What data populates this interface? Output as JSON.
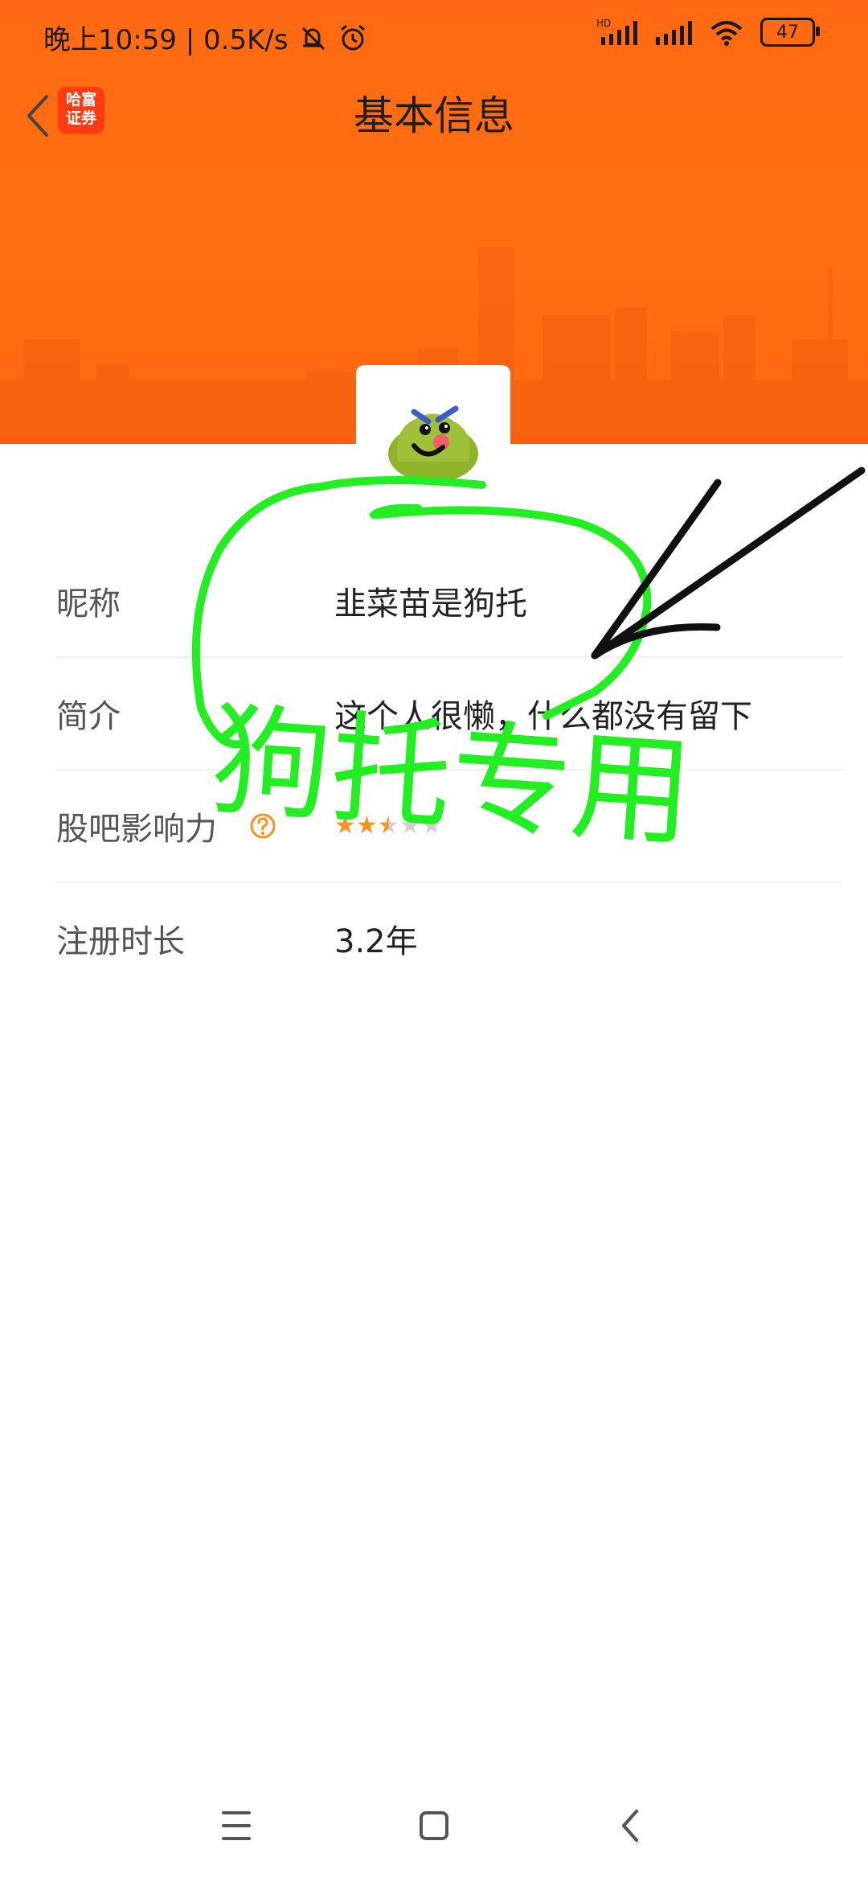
{
  "status_bar": {
    "time_speed": "晚上10:59 | 0.5K/s",
    "network_badge": "HD",
    "battery": "47",
    "icons": [
      "mute-bell-icon",
      "alarm-icon",
      "signal-icon",
      "signal-icon",
      "wifi-icon",
      "battery-icon"
    ]
  },
  "nav": {
    "title": "基本信息",
    "brand": "哈富证券",
    "back_icon": "chevron-left-icon"
  },
  "colors": {
    "header": "#ff6a13",
    "brand": "#ff3b12",
    "star": "#f7931e",
    "annotation_green": "#22ee22",
    "annotation_black": "#111111"
  },
  "profile": {
    "rows": [
      {
        "label": "昵称",
        "value": "韭菜苗是狗托"
      },
      {
        "label": "简介",
        "value": "这个人很懒，什么都没有留下"
      },
      {
        "label": "股吧影响力",
        "rating": 2.5,
        "max": 5
      },
      {
        "label": "注册时长",
        "value": "3.2年"
      }
    ]
  },
  "annotation": {
    "handwritten_text": "狗托专用"
  },
  "system_nav": [
    "menu-icon",
    "home-icon",
    "back-icon"
  ]
}
